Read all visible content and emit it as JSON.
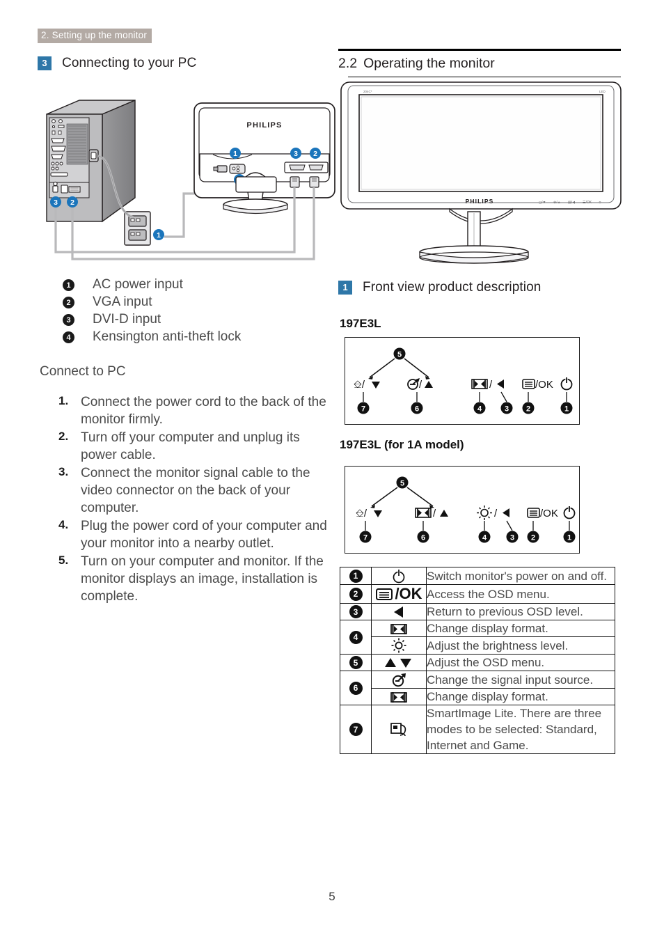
{
  "running_header": "2. Setting up the monitor",
  "left": {
    "section": {
      "number": "3",
      "title": "Connecting to your PC"
    },
    "connector_legend": [
      {
        "num": "1",
        "label": "AC power input"
      },
      {
        "num": "2",
        "label": "VGA input"
      },
      {
        "num": "3",
        "label": "DVI-D input"
      },
      {
        "num": "4",
        "label": "Kensington anti-theft lock"
      }
    ],
    "connect_heading": "Connect to PC",
    "steps": [
      {
        "num": "1.",
        "text": "Connect the power cord to the back of the monitor firmly."
      },
      {
        "num": "2.",
        "text": "Turn off your computer and unplug its power cable."
      },
      {
        "num": "3.",
        "text": "Connect the monitor signal cable to the video connector on the back of your computer."
      },
      {
        "num": "4.",
        "text": "Plug the power cord of your computer and your monitor into a nearby outlet."
      },
      {
        "num": "5.",
        "text": "Turn on your computer and monitor. If the monitor displays an image, installation is complete."
      }
    ],
    "diagram": {
      "monitor_brand": "PHILIPS",
      "callouts": [
        "1",
        "2",
        "3",
        "4"
      ]
    }
  },
  "right": {
    "section": {
      "number": "2.2",
      "title": "Operating the monitor"
    },
    "front_view": {
      "brand": "PHILIPS"
    },
    "subsection": {
      "number": "1",
      "title": "Front view product description"
    },
    "panel_one": {
      "model": "197E3L",
      "buttons": [
        {
          "num": "7",
          "glyph": "smartimage-down"
        },
        {
          "num": "6",
          "glyph": "input-up"
        },
        {
          "num": "5",
          "glyph": "updown-bracket"
        },
        {
          "num": "4",
          "glyph": "format"
        },
        {
          "num": "3",
          "glyph": "back"
        },
        {
          "num": "2",
          "glyph": "menu-ok",
          "ok_label": "/OK"
        },
        {
          "num": "1",
          "glyph": "power"
        }
      ]
    },
    "panel_two": {
      "model": "197E3L (for 1A model)",
      "buttons": [
        {
          "num": "7",
          "glyph": "smartimage-down"
        },
        {
          "num": "6",
          "glyph": "format-up"
        },
        {
          "num": "5",
          "glyph": "updown-bracket"
        },
        {
          "num": "4",
          "glyph": "brightness"
        },
        {
          "num": "3",
          "glyph": "back"
        },
        {
          "num": "2",
          "glyph": "menu-ok",
          "ok_label": "/OK"
        },
        {
          "num": "1",
          "glyph": "power"
        }
      ]
    },
    "table": {
      "rows": [
        {
          "num": "1",
          "icon": "power-icon",
          "desc": "Switch monitor's power on and off."
        },
        {
          "num": "2",
          "icon": "menu-ok-icon",
          "desc": "Access the OSD menu."
        },
        {
          "num": "3",
          "icon": "left-arrow-icon",
          "desc": "Return to previous OSD level."
        },
        {
          "num": "4",
          "icon": "format-icon",
          "desc": "Change display format.",
          "icon2": "brightness-icon",
          "desc2": "Adjust the brightness level."
        },
        {
          "num": "5",
          "icon": "up-down-arrows-icon",
          "desc": "Adjust the OSD menu."
        },
        {
          "num": "6",
          "icon": "input-source-icon",
          "desc": "Change the signal input source.",
          "icon2": "format-icon",
          "desc2": "Change display format."
        },
        {
          "num": "7",
          "icon": "smartimage-icon",
          "desc": "SmartImage Lite. There are three modes to be selected: Standard, Internet and Game."
        }
      ]
    }
  },
  "page_number": "5",
  "colors": {
    "header_band": "#b3aaa4",
    "badge_blue": "#2e77a8",
    "callout_blue": "#1b75bb",
    "body_text": "#4a4a4a"
  }
}
